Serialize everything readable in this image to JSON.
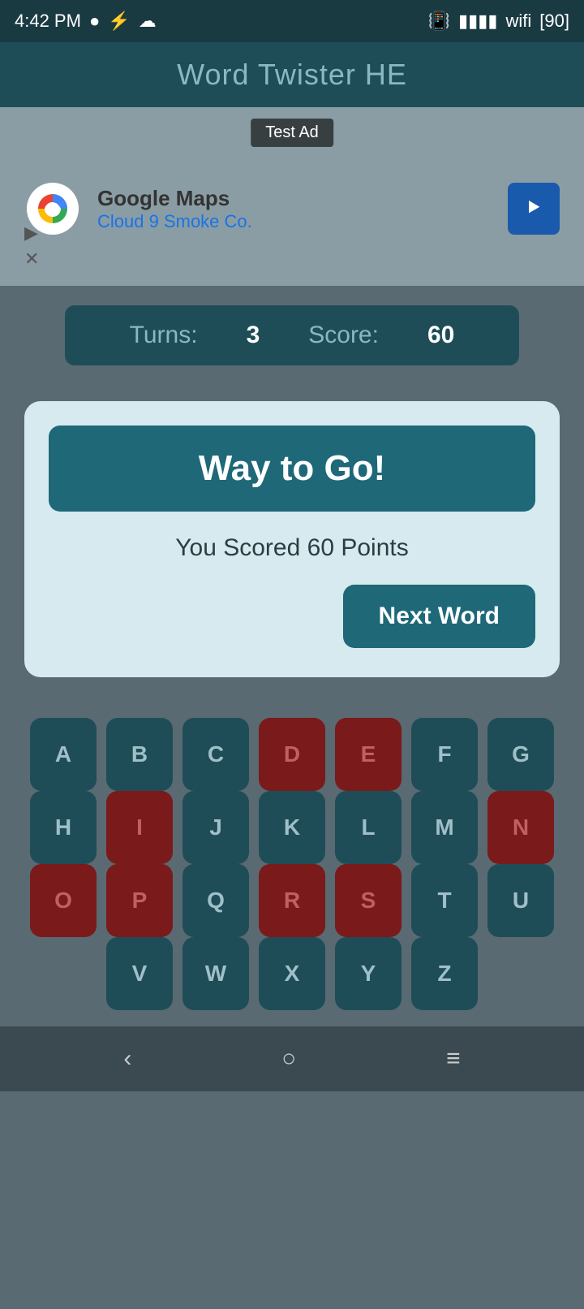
{
  "statusBar": {
    "time": "4:42 PM",
    "battery": "90"
  },
  "titleBar": {
    "title": "Word Twister HE"
  },
  "ad": {
    "label": "Test Ad",
    "company": "Google Maps",
    "subtitle": "Cloud 9 Smoke Co."
  },
  "scoreBar": {
    "turnsLabel": "Turns:",
    "turnsValue": "3",
    "scoreLabel": "Score:",
    "scoreValue": "60"
  },
  "modal": {
    "headerText": "Way to Go!",
    "bodyText": "You Scored 60 Points",
    "nextWordButton": "Next Word"
  },
  "keyboard": {
    "rows": [
      [
        {
          "letter": "A",
          "used": false
        },
        {
          "letter": "B",
          "used": false
        },
        {
          "letter": "C",
          "used": false
        },
        {
          "letter": "D",
          "used": true
        },
        {
          "letter": "E",
          "used": true
        },
        {
          "letter": "F",
          "used": false
        },
        {
          "letter": "G",
          "used": false
        }
      ],
      [
        {
          "letter": "H",
          "used": false
        },
        {
          "letter": "I",
          "used": true
        },
        {
          "letter": "J",
          "used": false
        },
        {
          "letter": "K",
          "used": false
        },
        {
          "letter": "L",
          "used": false
        },
        {
          "letter": "M",
          "used": false
        },
        {
          "letter": "N",
          "used": true
        }
      ],
      [
        {
          "letter": "O",
          "used": true
        },
        {
          "letter": "P",
          "used": true
        },
        {
          "letter": "Q",
          "used": false
        },
        {
          "letter": "R",
          "used": true
        },
        {
          "letter": "S",
          "used": true
        },
        {
          "letter": "T",
          "used": false
        },
        {
          "letter": "U",
          "used": false
        }
      ],
      [
        {
          "letter": "V",
          "used": false
        },
        {
          "letter": "W",
          "used": false
        },
        {
          "letter": "X",
          "used": false
        },
        {
          "letter": "Y",
          "used": false
        },
        {
          "letter": "Z",
          "used": false
        }
      ]
    ]
  },
  "navBar": {
    "backIcon": "‹",
    "homeIcon": "○",
    "menuIcon": "≡"
  }
}
